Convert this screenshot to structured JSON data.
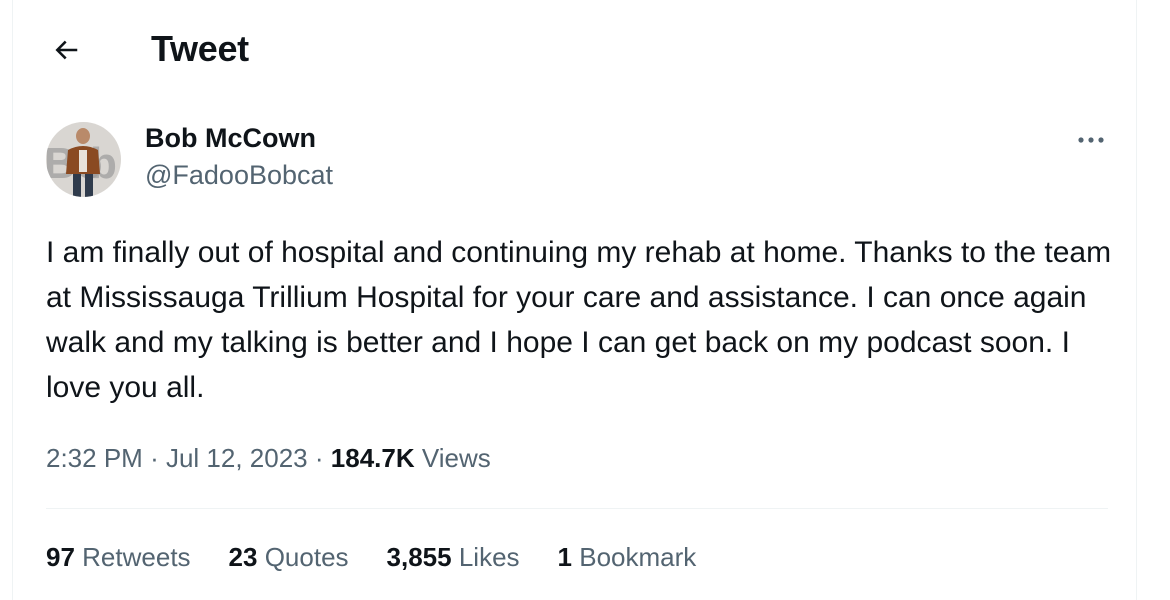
{
  "header": {
    "back_icon": "arrow-left-icon",
    "title": "Tweet"
  },
  "tweet": {
    "author": {
      "name": "Bob McCown",
      "handle": "@FadooBobcat",
      "avatar_icon": "avatar-photo"
    },
    "more_icon": "more-horizontal-icon",
    "text": "I am finally out of hospital and continuing my rehab at home. Thanks to the team at Mississauga Trillium Hospital for your care and assistance. I can once again walk and my talking is better and I hope I can get back on my podcast soon. I love you all.",
    "time": "2:32 PM",
    "separator": "·",
    "date": "Jul 12, 2023",
    "views_count": "184.7K",
    "views_label": "Views",
    "stats": {
      "retweets_count": "97",
      "retweets_label": "Retweets",
      "quotes_count": "23",
      "quotes_label": "Quotes",
      "likes_count": "3,855",
      "likes_label": "Likes",
      "bookmarks_count": "1",
      "bookmarks_label": "Bookmark"
    }
  },
  "colors": {
    "text_primary": "#0f1419",
    "text_secondary": "#536471",
    "border": "#eff3f4",
    "background": "#ffffff"
  }
}
